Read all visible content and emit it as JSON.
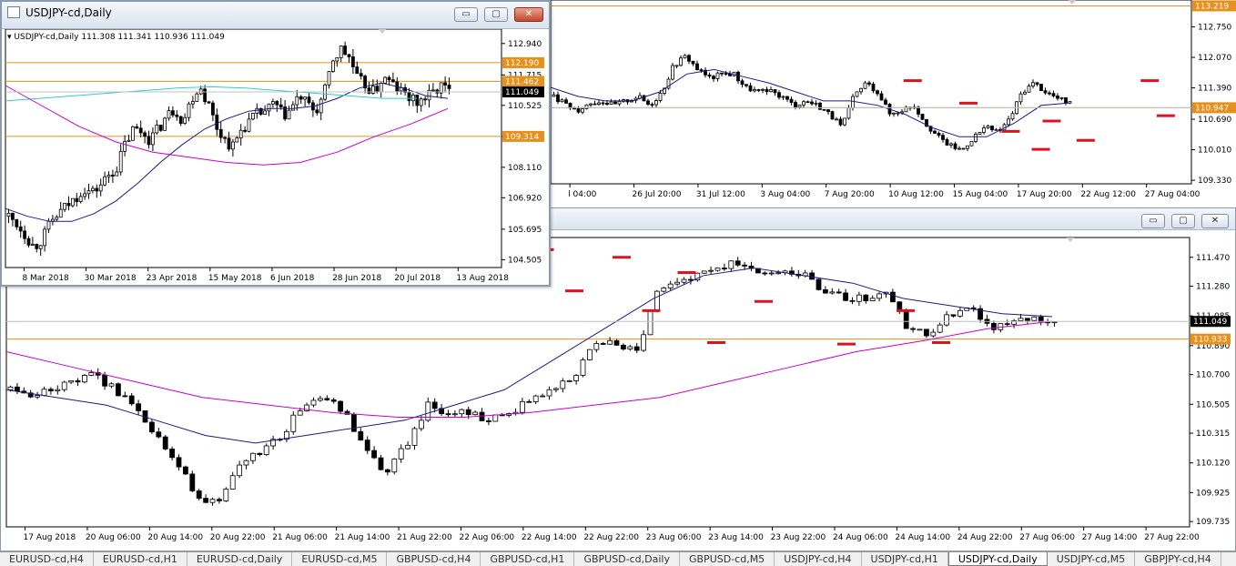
{
  "small_window": {
    "title": "USDJPY-cd,Daily",
    "info": "USDJPY-cd,Daily  111.308 111.341 110.936 111.049",
    "min_btn": "▭",
    "max_btn": "▢",
    "close_btn": "✕"
  },
  "top_window": {},
  "bottom_window": {
    "min_btn": "▭",
    "max_btn": "▢",
    "close_btn": "✕"
  },
  "tabs": [
    "EURUSD-cd,H4",
    "EURUSD-cd,H1",
    "EURUSD-cd,Daily",
    "EURUSD-cd,M5",
    "GBPUSD-cd,H4",
    "GBPUSD-cd,H1",
    "GBPUSD-cd,Daily",
    "GBPUSD-cd,M5",
    "USDJPY-cd,H4",
    "USDJPY-cd,H1",
    "USDJPY-cd,Daily",
    "USDJPY-cd,M5",
    "GBPJPY-cd,H4"
  ],
  "active_tab": 10,
  "colors": {
    "bull": "#ffffff",
    "bear": "#000000",
    "ma_fast": "#1a1a8c",
    "ma_slow": "#cc00cc",
    "ma_cyan": "#33cccc",
    "level": "#e6901e",
    "marker": "#e01020",
    "price_bg": "#000000"
  },
  "chart_data": [
    {
      "type": "candlestick",
      "title": "USDJPY-cd,Daily",
      "ylim": [
        104.2,
        113.5
      ],
      "ticks_y": [
        "112.940",
        "111.715",
        "110.525",
        "109.314",
        "108.110",
        "106.920",
        "105.695",
        "104.505"
      ],
      "ticks_y_values": [
        112.94,
        111.715,
        110.525,
        109.314,
        108.11,
        106.92,
        105.695,
        104.505
      ],
      "ticks_x": [
        "8 Mar 2018",
        "30 Mar 2018",
        "23 Apr 2018",
        "15 May 2018",
        "6 Jun 2018",
        "28 Jun 2018",
        "20 Jul 2018",
        "13 Aug 2018"
      ],
      "levels": [
        {
          "label": "112.190",
          "value": 112.19
        },
        {
          "label": "111.462",
          "value": 111.462
        },
        {
          "label": "109.314",
          "value": 109.314
        }
      ],
      "price_label": "111.049",
      "price": 111.049,
      "close_path": [
        106.2,
        105.9,
        105.5,
        105.0,
        105.3,
        105.9,
        106.3,
        106.6,
        106.9,
        107.3,
        107.1,
        107.4,
        107.8,
        108.1,
        109.0,
        109.6,
        109.5,
        109.2,
        109.6,
        110.1,
        110.4,
        109.9,
        110.8,
        111.3,
        110.6,
        109.7,
        109.2,
        108.9,
        109.6,
        109.9,
        110.2,
        110.3,
        110.6,
        110.1,
        110.4,
        110.9,
        110.5,
        110.3,
        111.0,
        112.3,
        112.7,
        112.4,
        111.5,
        111.3,
        111.0,
        111.6,
        111.4,
        111.1,
        110.9,
        110.6,
        110.8,
        111.0,
        111.3,
        111.05
      ],
      "ma_fast": [
        106.5,
        106.2,
        106.0,
        106.0,
        106.3,
        106.8,
        107.5,
        108.3,
        109.0,
        109.6,
        110.0,
        110.3,
        110.4,
        110.4,
        110.5,
        110.8,
        111.2,
        111.4,
        111.2,
        110.9,
        110.8
      ],
      "ma_cyan": [
        110.7,
        110.8,
        110.9,
        111.0,
        111.1,
        111.2,
        111.25,
        111.2,
        111.1,
        111.0,
        110.9,
        110.8,
        110.8
      ],
      "ma_slow": [
        111.3,
        110.5,
        109.7,
        109.1,
        108.7,
        108.5,
        108.3,
        108.2,
        108.3,
        108.7,
        109.3,
        109.8,
        110.4
      ]
    },
    {
      "type": "candlestick",
      "title": "",
      "ylim": [
        109.25,
        113.35
      ],
      "ticks_y": [
        "112.750",
        "112.070",
        "111.390",
        "110.690",
        "110.010",
        "109.330"
      ],
      "ticks_y_values": [
        112.75,
        112.07,
        111.39,
        110.69,
        110.01,
        109.33
      ],
      "ticks_x": [
        "l 04:00",
        "26 Jul 20:00",
        "31 Jul 12:00",
        "3 Aug 04:00",
        "7 Aug 20:00",
        "10 Aug 12:00",
        "15 Aug 04:00",
        "17 Aug 20:00",
        "22 Aug 12:00",
        "27 Aug 04:00"
      ],
      "levels": [
        {
          "label": "113.219",
          "value": 113.219
        },
        {
          "label": "110.947",
          "value": 110.947
        }
      ],
      "price_label": "110.947",
      "price": 110.947,
      "close_path": [
        111.2,
        111.0,
        110.9,
        111.05,
        111.1,
        111.0,
        111.1,
        111.2,
        111.0,
        111.3,
        111.9,
        112.1,
        111.8,
        111.6,
        111.7,
        111.7,
        111.4,
        111.3,
        111.3,
        111.2,
        111.0,
        111.1,
        111.0,
        110.8,
        110.5,
        111.2,
        111.5,
        111.3,
        110.8,
        110.9,
        111.0,
        110.6,
        110.3,
        110.1,
        110.0,
        110.3,
        110.5,
        110.4,
        110.7,
        111.3,
        111.5,
        111.3,
        111.15,
        111.05
      ],
      "ma_fast": [
        111.4,
        111.2,
        111.1,
        111.1,
        111.3,
        111.7,
        111.8,
        111.65,
        111.5,
        111.3,
        111.1,
        111.1,
        111.0,
        110.8,
        110.5,
        110.3,
        110.3,
        110.6,
        111.0,
        111.05
      ],
      "markers": [
        [
          0.565,
          111.55
        ],
        [
          0.652,
          111.05
        ],
        [
          0.718,
          110.42
        ],
        [
          0.765,
          110.02
        ],
        [
          0.782,
          110.65
        ],
        [
          0.835,
          110.22
        ],
        [
          0.935,
          111.55
        ],
        [
          0.96,
          110.77
        ]
      ]
    },
    {
      "type": "candlestick",
      "title": "",
      "ylim": [
        109.7,
        111.6
      ],
      "ticks_y": [
        "111.470",
        "111.280",
        "111.085",
        "110.890",
        "110.700",
        "110.505",
        "110.315",
        "110.120",
        "109.925",
        "109.735"
      ],
      "ticks_y_values": [
        111.47,
        111.28,
        111.085,
        110.89,
        110.7,
        110.505,
        110.315,
        110.12,
        109.925,
        109.735
      ],
      "ticks_x": [
        "17 Aug 2018",
        "20 Aug 06:00",
        "20 Aug 14:00",
        "20 Aug 22:00",
        "21 Aug 06:00",
        "21 Aug 14:00",
        "21 Aug 22:00",
        "22 Aug 06:00",
        "22 Aug 14:00",
        "22 Aug 22:00",
        "23 Aug 06:00",
        "23 Aug 14:00",
        "23 Aug 22:00",
        "24 Aug 06:00",
        "24 Aug 14:00",
        "24 Aug 22:00",
        "27 Aug 06:00",
        "27 Aug 14:00",
        "27 Aug 22:00"
      ],
      "levels": [
        {
          "label": "110.933",
          "value": 110.933
        }
      ],
      "price_label": "111.049",
      "price": 111.049,
      "close_path": [
        110.6,
        110.55,
        110.6,
        110.65,
        110.7,
        110.6,
        110.5,
        110.3,
        110.1,
        109.9,
        109.85,
        110.1,
        110.2,
        110.3,
        110.5,
        110.55,
        110.45,
        110.2,
        110.05,
        110.25,
        110.5,
        110.45,
        110.45,
        110.4,
        110.45,
        110.55,
        110.6,
        110.7,
        110.9,
        110.9,
        110.85,
        111.25,
        111.3,
        111.35,
        111.4,
        111.45,
        111.35,
        111.4,
        111.35,
        111.25,
        111.2,
        111.2,
        111.25,
        111.0,
        110.95,
        111.1,
        111.15,
        111.0,
        111.05,
        111.08,
        111.05
      ],
      "ma_fast": [
        110.6,
        110.55,
        110.5,
        110.4,
        110.3,
        110.25,
        110.3,
        110.35,
        110.4,
        110.5,
        110.6,
        110.8,
        111.0,
        111.2,
        111.35,
        111.4,
        111.35,
        111.3,
        111.2,
        111.15,
        111.1,
        111.08
      ],
      "ma_slow": [
        110.85,
        110.75,
        110.65,
        110.55,
        110.5,
        110.45,
        110.42,
        110.42,
        110.45,
        110.5,
        110.55,
        110.65,
        110.75,
        110.85,
        110.92,
        111.0,
        111.05
      ],
      "markers": [
        [
          0.455,
          111.52
        ],
        [
          0.48,
          111.25
        ],
        [
          0.52,
          111.47
        ],
        [
          0.545,
          111.12
        ],
        [
          0.575,
          111.37
        ],
        [
          0.6,
          110.91
        ],
        [
          0.64,
          111.18
        ],
        [
          0.71,
          110.9
        ],
        [
          0.76,
          111.12
        ],
        [
          0.79,
          110.91
        ]
      ]
    }
  ]
}
